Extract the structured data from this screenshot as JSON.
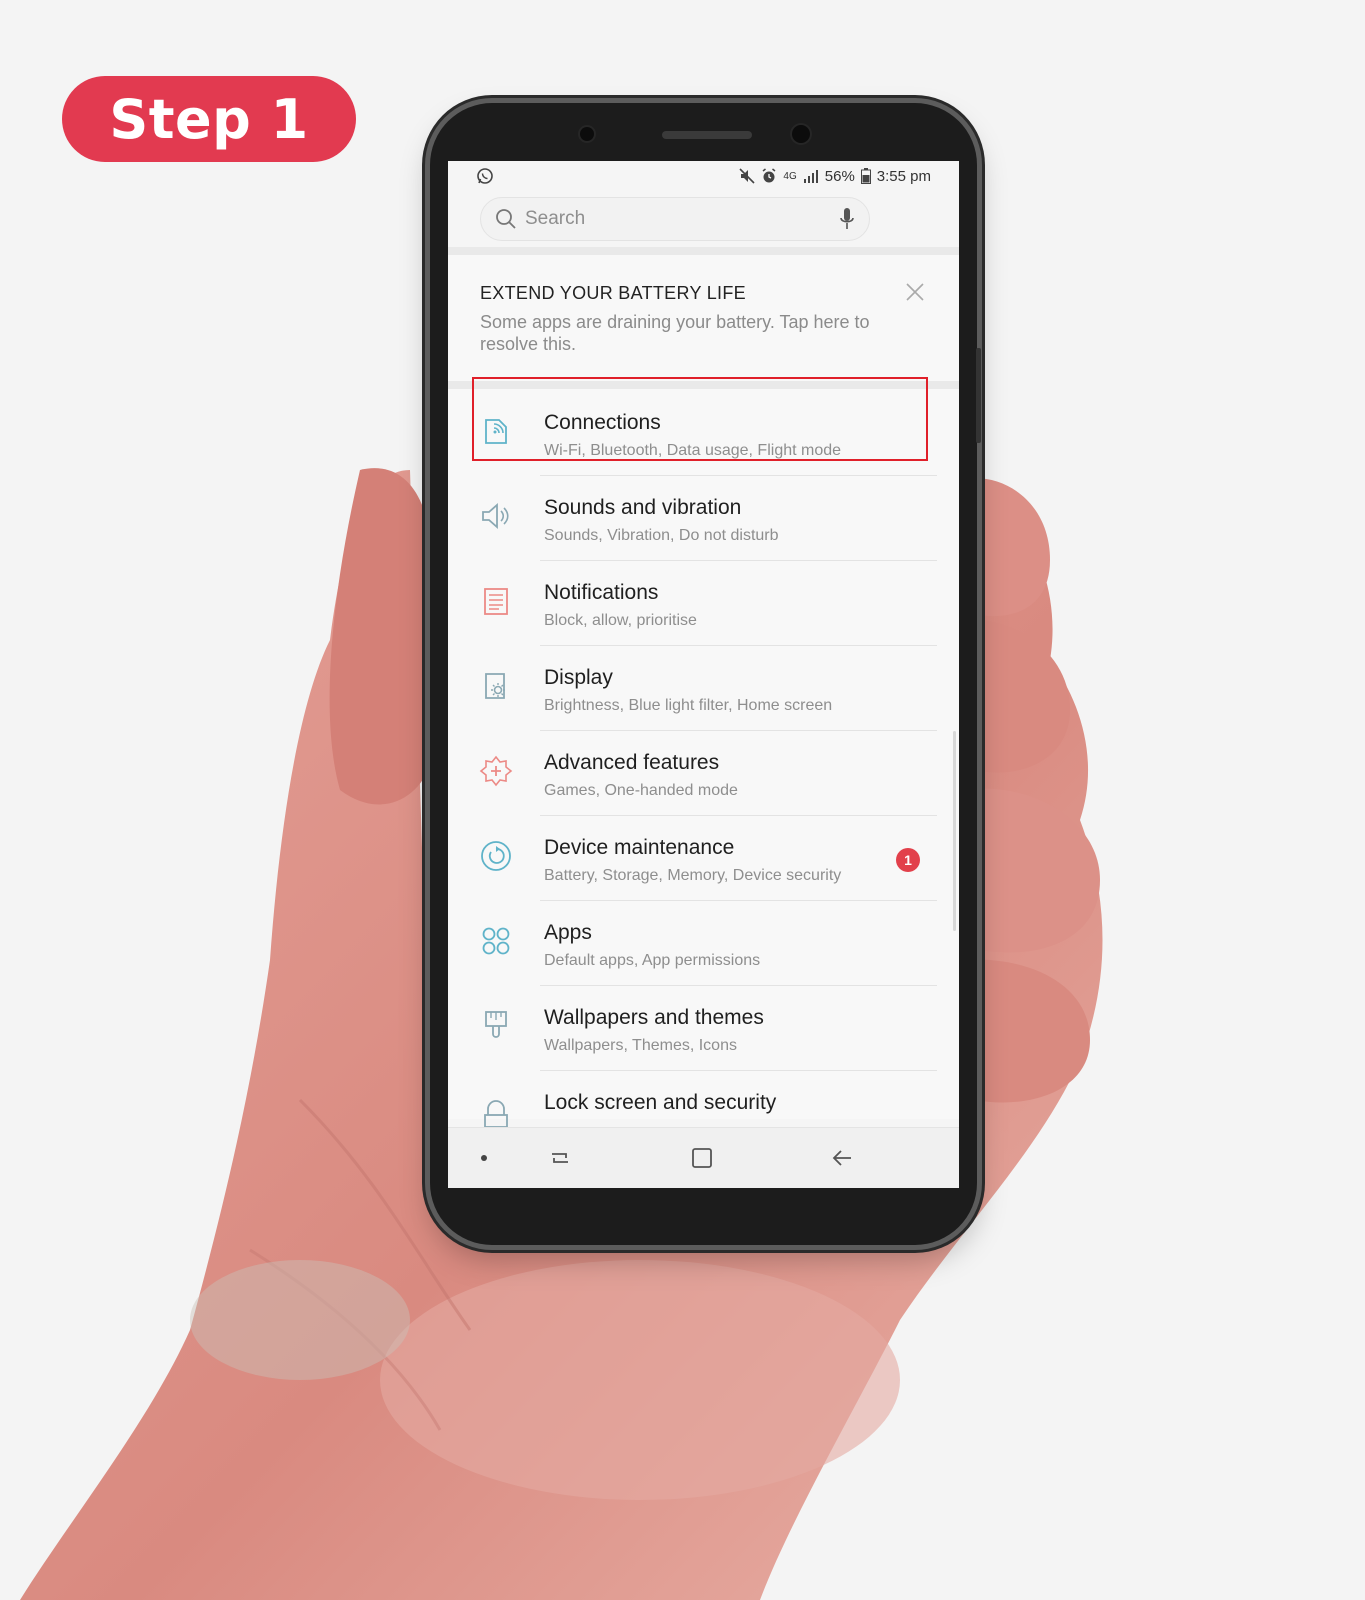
{
  "step_badge": {
    "label": "Step 1"
  },
  "status_bar": {
    "network": "4G",
    "battery_percent": "56%",
    "time": "3:55 pm"
  },
  "search": {
    "placeholder": "Search"
  },
  "battery_card": {
    "title": "EXTEND YOUR BATTERY LIFE",
    "description": "Some apps are draining your battery. Tap here to resolve this."
  },
  "settings": {
    "items": [
      {
        "title": "Connections",
        "subtitle": "Wi-Fi, Bluetooth, Data usage, Flight mode",
        "icon": "connections-icon"
      },
      {
        "title": "Sounds and vibration",
        "subtitle": "Sounds, Vibration, Do not disturb",
        "icon": "speaker-icon"
      },
      {
        "title": "Notifications",
        "subtitle": "Block, allow, prioritise",
        "icon": "notifications-icon"
      },
      {
        "title": "Display",
        "subtitle": "Brightness, Blue light filter, Home screen",
        "icon": "display-icon"
      },
      {
        "title": "Advanced features",
        "subtitle": "Games, One-handed mode",
        "icon": "advanced-features-icon"
      },
      {
        "title": "Device maintenance",
        "subtitle": "Battery, Storage, Memory, Device security",
        "icon": "device-maintenance-icon",
        "badge": "1"
      },
      {
        "title": "Apps",
        "subtitle": "Default apps, App permissions",
        "icon": "apps-icon"
      },
      {
        "title": "Wallpapers and themes",
        "subtitle": "Wallpapers, Themes, Icons",
        "icon": "paintbrush-icon"
      },
      {
        "title": "Lock screen and security",
        "subtitle": "",
        "icon": "lock-icon"
      }
    ]
  },
  "colors": {
    "badge_red": "#e23a50",
    "highlight_red": "#e0202a",
    "icon_teal": "#5fb3c9",
    "icon_coral": "#ec8a86",
    "notification_badge": "#e2404b"
  }
}
